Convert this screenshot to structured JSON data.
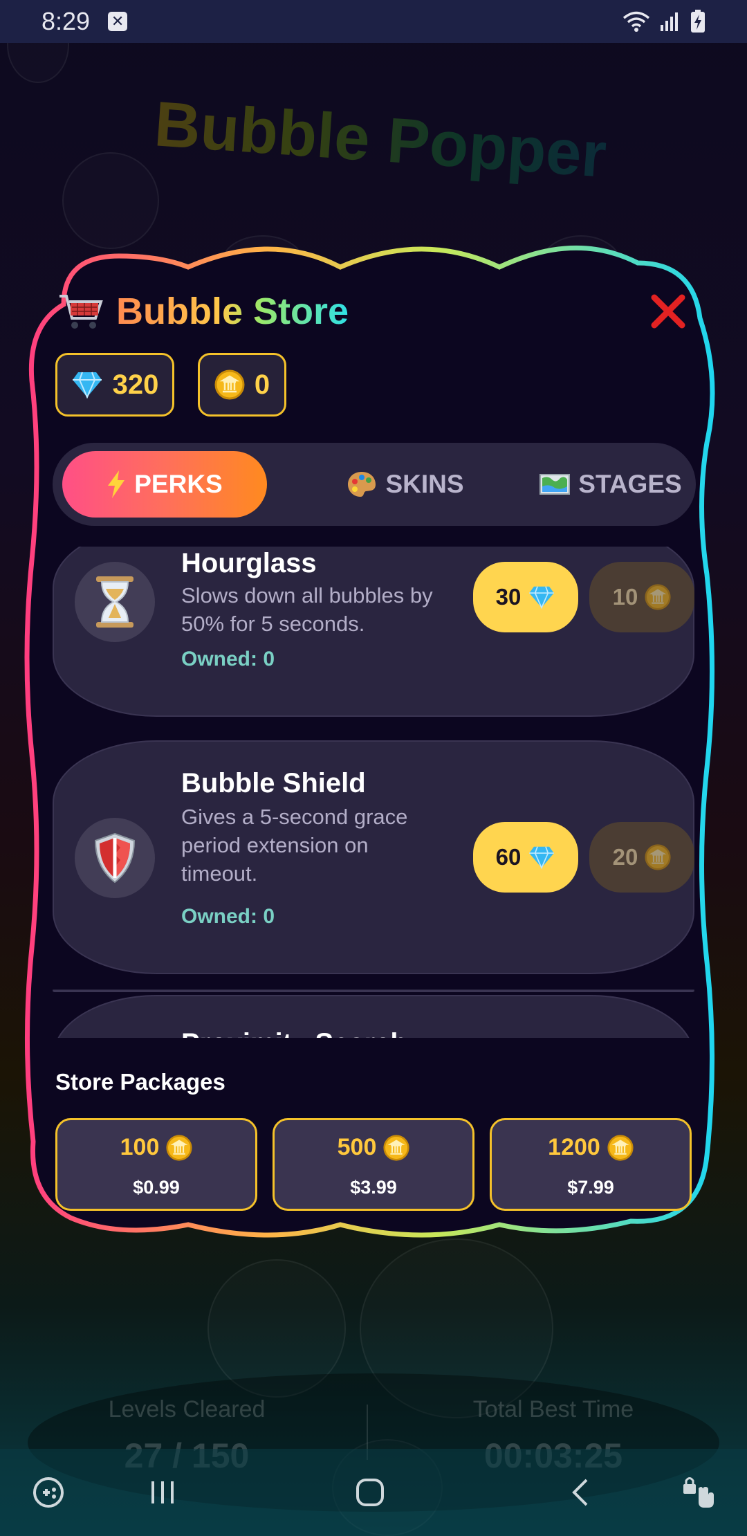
{
  "status_bar": {
    "time": "8:29"
  },
  "background": {
    "game_title": "Bubble Popper",
    "stats": [
      {
        "label": "Levels Cleared",
        "value": "27 / 150"
      },
      {
        "label": "Total Best Time",
        "value": "00:03:25"
      }
    ]
  },
  "store": {
    "title": "Bubble Store",
    "gems": "320",
    "coins": "0",
    "tabs": [
      {
        "label": "PERKS",
        "icon": "lightning-icon",
        "active": true
      },
      {
        "label": "SKINS",
        "icon": "palette-icon",
        "active": false
      },
      {
        "label": "STAGES",
        "icon": "map-icon",
        "active": false
      }
    ],
    "perks": [
      {
        "name": "Hourglass",
        "icon": "hourglass-icon",
        "description": "Slows down all bubbles by 50% for 5 seconds.",
        "owned": "Owned: 0",
        "gem_price": "30",
        "coin_price": "10"
      },
      {
        "name": "Bubble Shield",
        "icon": "shield-icon",
        "description": "Gives a 5-second grace period extension on timeout.",
        "owned": "Owned: 0",
        "gem_price": "60",
        "coin_price": "20"
      },
      {
        "name": "Proximity Search",
        "icon": "search-icon"
      }
    ],
    "packages_title": "Store Packages",
    "packages": [
      {
        "amount": "100",
        "price": "$0.99"
      },
      {
        "amount": "500",
        "price": "$3.99"
      },
      {
        "amount": "1200",
        "price": "$7.99"
      }
    ]
  },
  "colors": {
    "accent_gold": "#f5c22a",
    "gem_button": "#ffd54f",
    "coin_button_disabled": "#4b3d33",
    "tab_active_start": "#ff4f86",
    "tab_active_end": "#ff8a1f",
    "owned_text": "#7ad0c4",
    "close_red": "#e32222"
  }
}
